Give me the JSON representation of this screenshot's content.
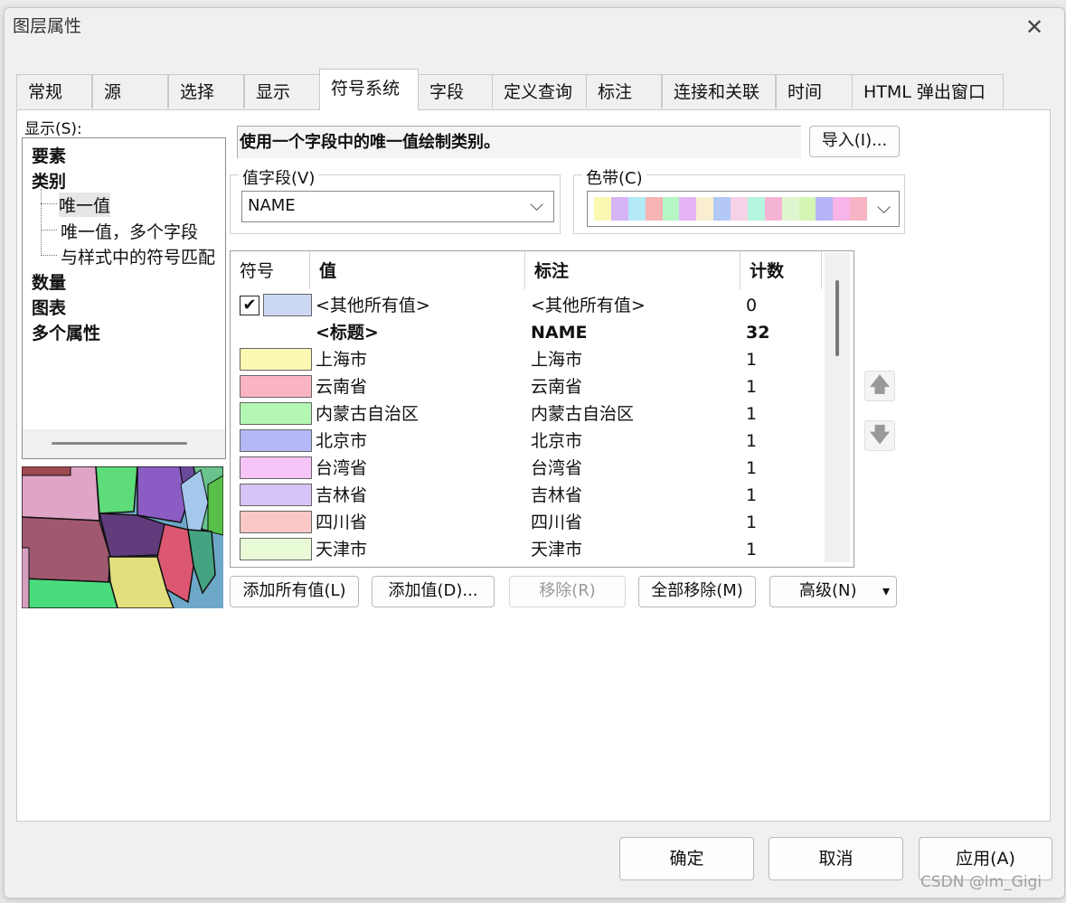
{
  "dialog": {
    "title": "图层属性",
    "close_glyph": "✕"
  },
  "tabs": [
    "常规",
    "源",
    "选择",
    "显示",
    "符号系统",
    "字段",
    "定义查询",
    "标注",
    "连接和关联",
    "时间",
    "HTML 弹出窗口"
  ],
  "active_tab": "符号系统",
  "show": {
    "label": "显示(S):",
    "tree": {
      "features": "要素",
      "categories": "类别",
      "unique_values": "唯一值",
      "unique_values_many": "唯一值，多个字段",
      "match_to_style": "与样式中的符号匹配",
      "quantities": "数量",
      "charts": "图表",
      "multiple_attributes": "多个属性"
    }
  },
  "description": "使用一个字段中的唯一值绘制类别。",
  "import_button": "导入(I)...",
  "value_field": {
    "label": "值字段(V)",
    "value": "NAME"
  },
  "color_ramp": {
    "label": "色带(C)",
    "colors": [
      "#fbf8b4",
      "#d6b4f6",
      "#b4e9f6",
      "#f6b4b4",
      "#b4f6c4",
      "#e6b4f6",
      "#faeed0",
      "#b4c8f6",
      "#f6d2e6",
      "#b4f6e0",
      "#f6b4d4",
      "#e0f6d0",
      "#d4f6b4",
      "#b4b4f6",
      "#f6b4e8",
      "#f6b4c4"
    ]
  },
  "table": {
    "headers": {
      "symbol": "符号",
      "value": "值",
      "label": "标注",
      "count": "计数"
    },
    "other_row": {
      "value": "<其他所有值>",
      "label": "<其他所有值>",
      "count": "0",
      "checked": true,
      "color": "#cdd8f4"
    },
    "heading_row": {
      "value": "<标题>",
      "label": "NAME",
      "count": "32"
    },
    "rows": [
      {
        "value": "上海市",
        "label": "上海市",
        "count": "1",
        "color": "#fbf8b4"
      },
      {
        "value": "云南省",
        "label": "云南省",
        "count": "1",
        "color": "#fbb4c4"
      },
      {
        "value": "内蒙古自治区",
        "label": "内蒙古自治区",
        "count": "1",
        "color": "#b4f6b4"
      },
      {
        "value": "北京市",
        "label": "北京市",
        "count": "1",
        "color": "#b4b8f6"
      },
      {
        "value": "台湾省",
        "label": "台湾省",
        "count": "1",
        "color": "#f6c4f6"
      },
      {
        "value": "吉林省",
        "label": "吉林省",
        "count": "1",
        "color": "#d6c4f6"
      },
      {
        "value": "四川省",
        "label": "四川省",
        "count": "1",
        "color": "#fbc8c8"
      },
      {
        "value": "天津市",
        "label": "天津市",
        "count": "1",
        "color": "#e8fbd6"
      }
    ]
  },
  "move_up_glyph": "🡅",
  "move_down_glyph": "🡇",
  "buttons": {
    "add_all": "添加所有值(L)",
    "add": "添加值(D)...",
    "remove": "移除(R)",
    "remove_all": "全部移除(M)",
    "advanced": "高级(N)",
    "advanced_arrow": "▾"
  },
  "footer": {
    "ok": "确定",
    "cancel": "取消",
    "apply": "应用(A)"
  },
  "watermark": "CSDN @lm_Gigi"
}
